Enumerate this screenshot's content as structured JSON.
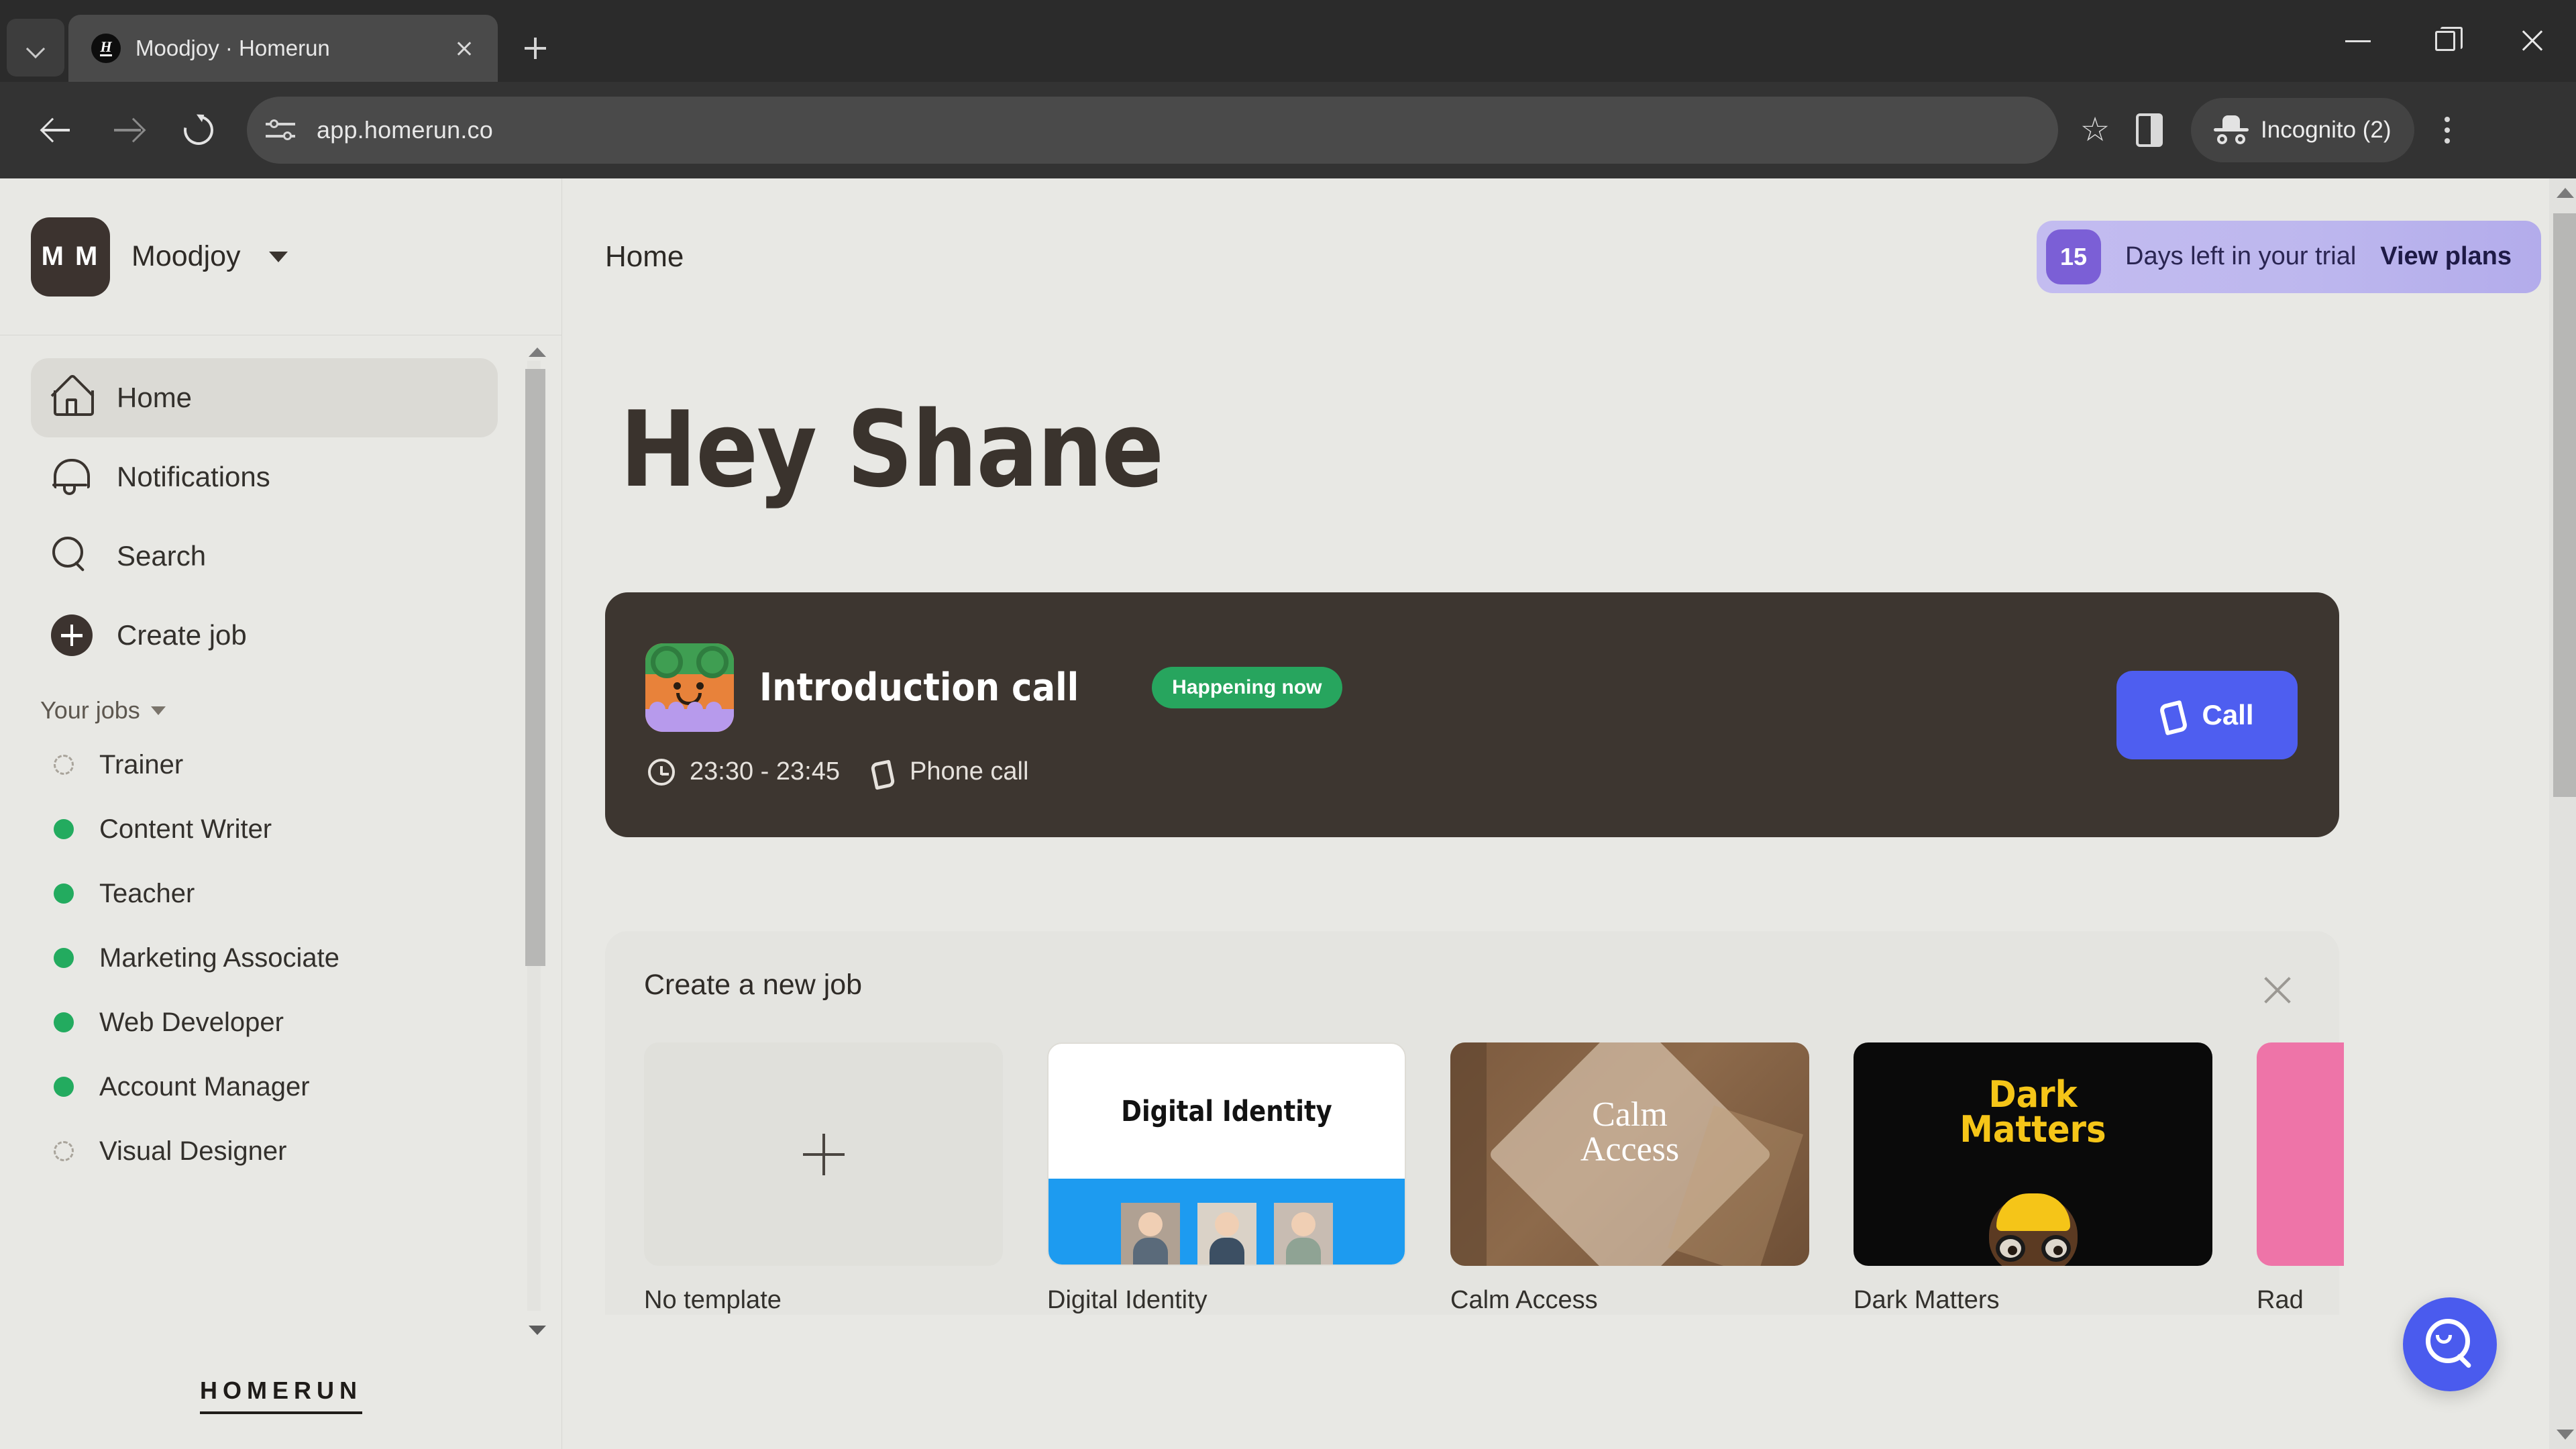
{
  "browser": {
    "tab": {
      "title": "Moodjoy · Homerun",
      "favicon_letter": "H"
    },
    "tab_search_label": "tab-search",
    "new_tab_label": "New tab",
    "url": "app.homerun.co",
    "profile_label": "Incognito (2)",
    "nav": {
      "back": "Back",
      "forward": "Forward",
      "reload": "Reload"
    },
    "actions": {
      "bookmark": "Bookmark this tab",
      "side_panel": "Side panel",
      "menu": "Customize and control Chrome"
    },
    "window": {
      "minimize": "Minimize",
      "maximize": "Maximize",
      "close": "Close"
    }
  },
  "sidebar": {
    "org": {
      "initials": "M M",
      "name": "Moodjoy"
    },
    "nav_items": [
      {
        "label": "Home",
        "icon": "home-icon",
        "active": true
      },
      {
        "label": "Notifications",
        "icon": "bell-icon",
        "active": false
      },
      {
        "label": "Search",
        "icon": "search-icon",
        "active": false
      },
      {
        "label": "Create job",
        "icon": "plus-circle-icon",
        "active": false
      }
    ],
    "jobs_section_label": "Your jobs",
    "jobs": [
      {
        "label": "Trainer",
        "status": "draft"
      },
      {
        "label": "Content Writer",
        "status": "published"
      },
      {
        "label": "Teacher",
        "status": "published"
      },
      {
        "label": "Marketing Associate",
        "status": "published"
      },
      {
        "label": "Web Developer",
        "status": "published"
      },
      {
        "label": "Account Manager",
        "status": "published"
      },
      {
        "label": "Visual Designer",
        "status": "draft"
      }
    ],
    "footer_logo": "HOMERUN"
  },
  "header": {
    "title": "Home",
    "trial": {
      "days": "15",
      "text": "Days left in your trial",
      "link": "View plans"
    }
  },
  "main": {
    "greeting": "Hey Shane",
    "event": {
      "title": "Introduction call",
      "badge": "Happening now",
      "time": "23:30 - 23:45",
      "type": "Phone call",
      "action_label": "Call"
    },
    "new_job": {
      "title": "Create a new job",
      "close_label": "Close",
      "templates": [
        {
          "name": "No template",
          "kind": "empty"
        },
        {
          "name": "Digital Identity",
          "kind": "digital-identity",
          "cover_text": "Digital Identity"
        },
        {
          "name": "Calm Access",
          "kind": "calm-access",
          "cover_text_line1": "Calm",
          "cover_text_line2": "Access"
        },
        {
          "name": "Dark Matters",
          "kind": "dark-matters",
          "cover_text_line1": "Dark",
          "cover_text_line2": "Matters"
        },
        {
          "name": "Rad",
          "kind": "partial"
        }
      ]
    },
    "fab_label": "Search"
  },
  "colors": {
    "accent_blue": "#4a5bee",
    "status_green": "#27a55e",
    "trial_purple": "#7b5fd6",
    "dark_card": "#3d3630",
    "page_bg": "#e8e8e4"
  }
}
